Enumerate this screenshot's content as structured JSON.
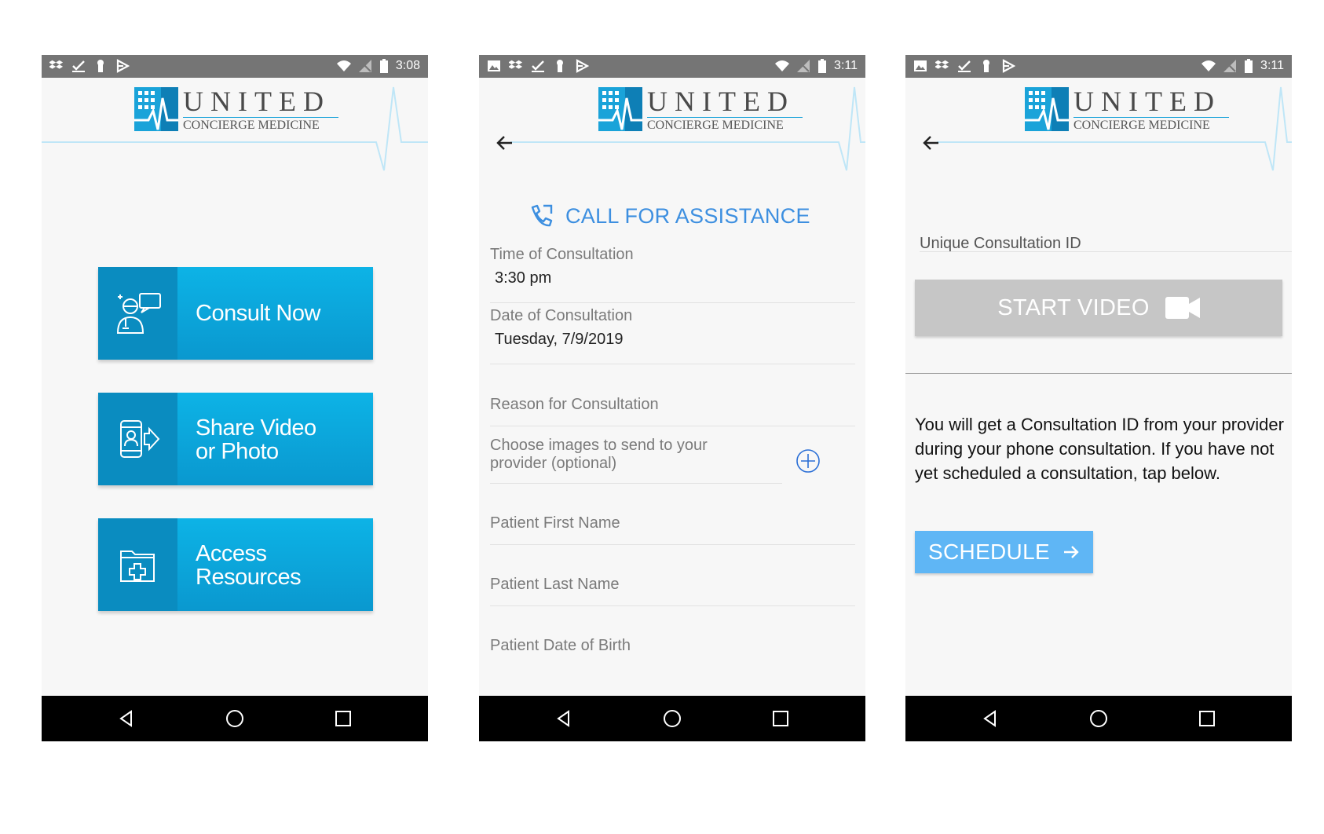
{
  "brand": {
    "title": "UNITED",
    "subtitle": "CONCIERGE MEDICINE"
  },
  "screens": [
    {
      "status": {
        "time": "3:08"
      },
      "tiles": [
        {
          "label_line1": "Consult Now",
          "label_line2": "",
          "icon": "doctor-chat-icon"
        },
        {
          "label_line1": "Share Video",
          "label_line2": "or Photo",
          "icon": "phone-video-share-icon"
        },
        {
          "label_line1": "Access",
          "label_line2": "Resources",
          "icon": "medical-folder-icon"
        }
      ]
    },
    {
      "status": {
        "time": "3:11"
      },
      "call_label": "CALL FOR ASSISTANCE",
      "fields": {
        "time_label": "Time of Consultation",
        "time_value": "3:30 pm",
        "date_label": "Date of Consultation",
        "date_value": "Tuesday, 7/9/2019",
        "reason_label": "Reason for Consultation",
        "images_line1": "Choose images to send to your",
        "images_line2": "provider (optional)",
        "first_name_label": "Patient First Name",
        "last_name_label": "Patient Last Name",
        "dob_label": "Patient Date of Birth"
      }
    },
    {
      "status": {
        "time": "3:11"
      },
      "uid_label": "Unique Consultation ID",
      "start_video_label": "START VIDEO",
      "info_text": "You will get a Consultation ID from your provider during your phone consultation. If you have not yet scheduled a consultation, tap below.",
      "schedule_label": "SCHEDULE"
    }
  ],
  "colors": {
    "accent_blue": "#0aa6dc",
    "call_blue": "#3d8fe0",
    "schedule_blue": "#5fb6f5",
    "disabled_gray": "#c6c6c6"
  }
}
